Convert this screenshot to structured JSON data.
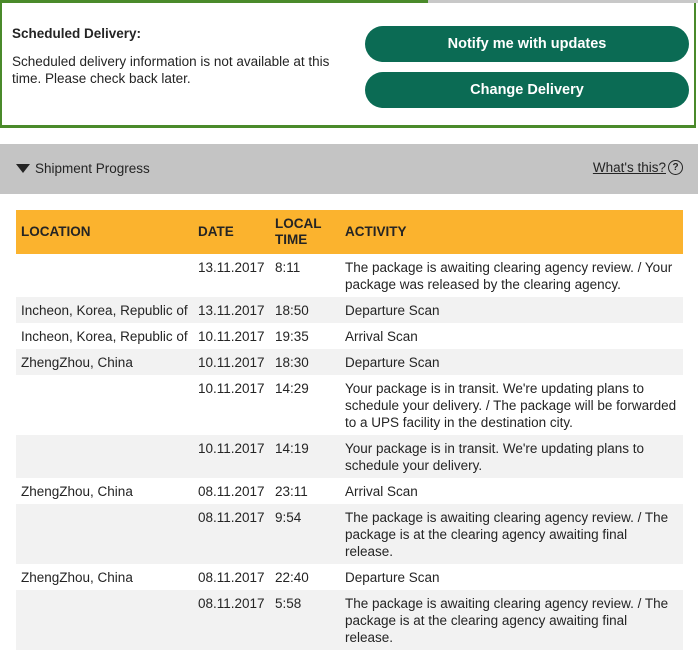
{
  "scheduled": {
    "title": "Scheduled Delivery:",
    "message": "Scheduled delivery information is not available at this time. Please check back later.",
    "notify_label": "Notify me with updates",
    "change_label": "Change Delivery"
  },
  "progress": {
    "title": "Shipment Progress",
    "whats_this": "What's this?",
    "help_glyph": "?",
    "headers": {
      "location": "LOCATION",
      "date": "DATE",
      "time": "LOCAL TIME",
      "activity": "ACTIVITY"
    },
    "rows": [
      {
        "location": "",
        "date": "13.11.2017",
        "time": "8:11",
        "activity": "The package is awaiting clearing agency review. / Your package was released by the clearing agency."
      },
      {
        "location": "Incheon, Korea, Republic of",
        "date": "13.11.2017",
        "time": "18:50",
        "activity": "Departure Scan"
      },
      {
        "location": "Incheon, Korea, Republic of",
        "date": "10.11.2017",
        "time": "19:35",
        "activity": "Arrival Scan"
      },
      {
        "location": "ZhengZhou, China",
        "date": "10.11.2017",
        "time": "18:30",
        "activity": "Departure Scan"
      },
      {
        "location": "",
        "date": "10.11.2017",
        "time": "14:29",
        "activity": "Your package is in transit. We're updating plans to schedule your delivery. / The package will be forwarded to a UPS facility in the destination city."
      },
      {
        "location": "",
        "date": "10.11.2017",
        "time": "14:19",
        "activity": "Your package is in transit. We're updating plans to schedule your delivery."
      },
      {
        "location": "ZhengZhou, China",
        "date": "08.11.2017",
        "time": "23:11",
        "activity": "Arrival Scan"
      },
      {
        "location": "",
        "date": "08.11.2017",
        "time": "9:54",
        "activity": "The package is awaiting clearing agency review. / The package is at the clearing agency awaiting final release."
      },
      {
        "location": "ZhengZhou, China",
        "date": "08.11.2017",
        "time": "22:40",
        "activity": "Departure Scan"
      },
      {
        "location": "",
        "date": "08.11.2017",
        "time": "5:58",
        "activity": "The package is awaiting clearing agency review. / The package is at the clearing agency awaiting final release."
      }
    ]
  },
  "colors": {
    "brand_green": "#0b6b54",
    "accent_green": "#4a8a2a",
    "header_yellow": "#fbb32e",
    "panel_gray": "#c4c4c4"
  },
  "icons": {
    "caret": "caret-down-icon",
    "help": "help-circle-icon"
  }
}
